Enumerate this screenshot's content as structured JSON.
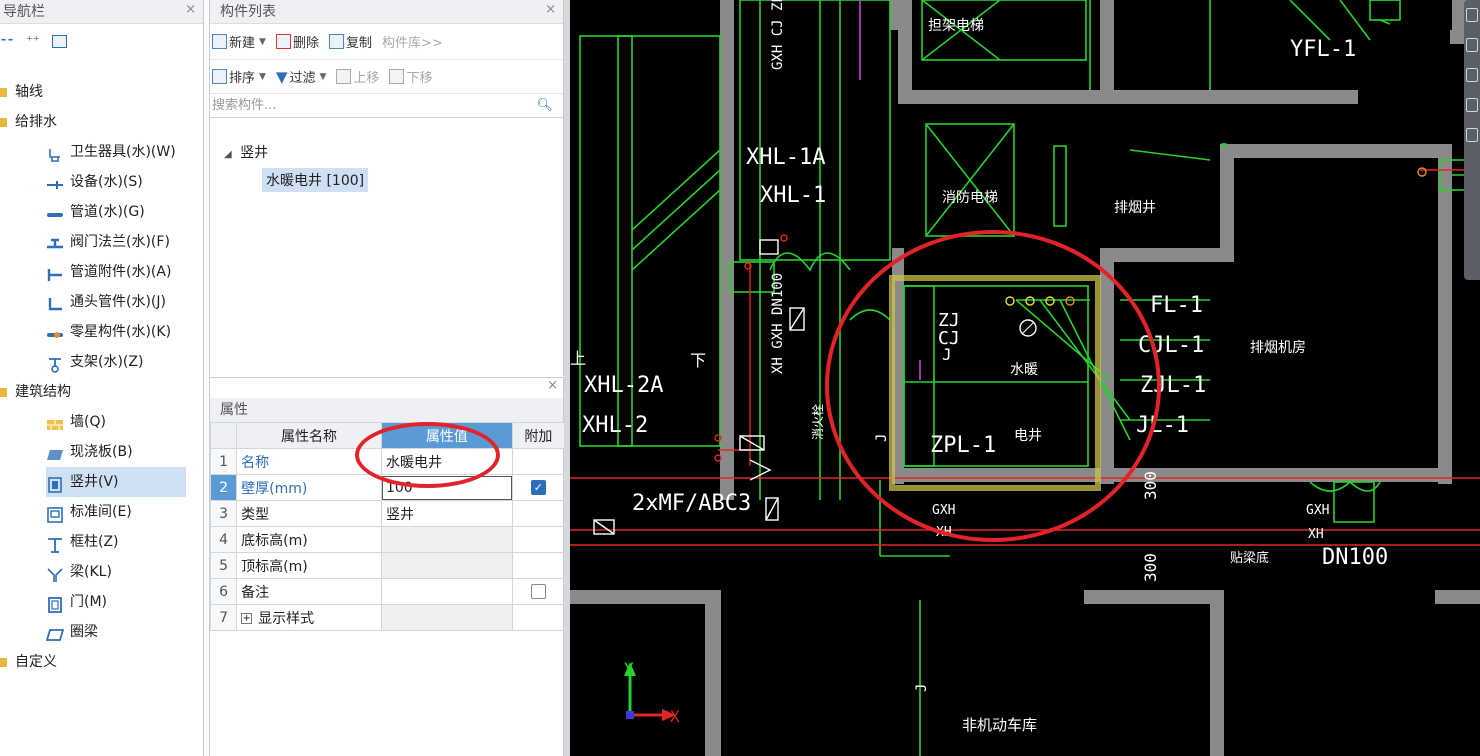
{
  "nav": {
    "title": "导航栏",
    "close": "×",
    "items": [
      {
        "label": "轴线",
        "icon": "folder-icon"
      },
      {
        "label": "给排水",
        "icon": "folder-icon"
      },
      {
        "label": "卫生器具(水)(W)",
        "icon": "sanitary-fixture-icon"
      },
      {
        "label": "设备(水)(S)",
        "icon": "equipment-icon"
      },
      {
        "label": "管道(水)(G)",
        "icon": "pipe-icon"
      },
      {
        "label": "阀门法兰(水)(F)",
        "icon": "valve-icon"
      },
      {
        "label": "管道附件(水)(A)",
        "icon": "pipe-accessory-icon"
      },
      {
        "label": "通头管件(水)(J)",
        "icon": "pipe-fitting-icon"
      },
      {
        "label": "零星构件(水)(K)",
        "icon": "misc-component-icon"
      },
      {
        "label": "支架(水)(Z)",
        "icon": "bracket-icon"
      },
      {
        "label": "建筑结构",
        "icon": "folder-icon"
      },
      {
        "label": "墙(Q)",
        "icon": "wall-icon"
      },
      {
        "label": "现浇板(B)",
        "icon": "slab-icon"
      },
      {
        "label": "竖井(V)",
        "icon": "shaft-icon"
      },
      {
        "label": "标准间(E)",
        "icon": "standard-room-icon"
      },
      {
        "label": "框柱(Z)",
        "icon": "column-icon"
      },
      {
        "label": "梁(KL)",
        "icon": "beam-icon"
      },
      {
        "label": "门(M)",
        "icon": "door-icon"
      },
      {
        "label": "圈梁",
        "icon": "ring-beam-icon"
      },
      {
        "label": "自定义",
        "icon": "folder-icon"
      }
    ]
  },
  "comp": {
    "title": "构件列表",
    "close": "×",
    "toolbar1": {
      "new": "新建",
      "delete": "删除",
      "copy": "复制",
      "library": "构件库>>"
    },
    "toolbar2": {
      "sort": "排序",
      "filter": "过滤",
      "up": "上移",
      "down": "下移"
    },
    "search_placeholder": "搜索构件...",
    "tree_root": "竖井",
    "tree_child": "水暖电井 [100]"
  },
  "props": {
    "title": "属性",
    "close": "×",
    "headers": {
      "num": "",
      "name": "属性名称",
      "value": "属性值",
      "extra": "附加"
    },
    "rows": [
      {
        "num": "1",
        "name": "名称",
        "value": "水暖电井",
        "checked": null
      },
      {
        "num": "2",
        "name": "壁厚(mm)",
        "value": "100",
        "checked": true
      },
      {
        "num": "3",
        "name": "类型",
        "value": "竖井",
        "checked": null
      },
      {
        "num": "4",
        "name": "底标高(m)",
        "value": "",
        "checked": null
      },
      {
        "num": "5",
        "name": "顶标高(m)",
        "value": "",
        "checked": null
      },
      {
        "num": "6",
        "name": "备注",
        "value": "",
        "checked": false
      },
      {
        "num": "7",
        "name": "显示样式",
        "value": "",
        "checked": null
      }
    ],
    "expand_symbol": "+",
    "check_symbol": "✓"
  },
  "cad": {
    "labels": {
      "freight_elevator": "担架电梯",
      "fire_elevator": "消防电梯",
      "smoke_shaft": "排烟井",
      "smoke_room": "排烟机房",
      "water_heating": "水暖",
      "electric_shaft": "电井",
      "garage": "非机动车库",
      "floor_label": "贴梁底",
      "yfl": "YFL-1",
      "xhl1a": "XHL-1A",
      "xhl1": "XHL-1",
      "xhl2a": "XHL-2A",
      "xhl2": "XHL-2",
      "fl1": "FL-1",
      "cjl1": "CJL-1",
      "zjl1": "ZJL-1",
      "jl1": "JL-1",
      "zpl1": "ZPL-1",
      "extinguisher": "2xMF/ABC3",
      "dn100a": "DN100",
      "dn100b": "DN100",
      "gxh1": "GXH",
      "xh1": "XH",
      "gxh2": "GXH",
      "xh2": "XH",
      "gxh3": "GXH",
      "xh3": "XH",
      "zj": "ZJ",
      "cj": "CJ",
      "j": "J",
      "dim1": "300",
      "dim2": "300",
      "up": "上",
      "down": "下",
      "axis_x": "X",
      "axis_y": "Y",
      "vlabel1": "GXH  CJ ZP",
      "vlabel2": "XH  GXH  DN100",
      "vlabel3": "消火栓",
      "vlabel4": "J",
      "vlabel5": "J"
    }
  }
}
